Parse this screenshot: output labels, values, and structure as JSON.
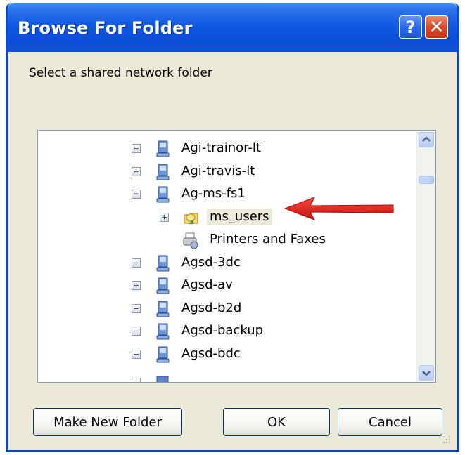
{
  "window": {
    "title": "Browse For Folder",
    "help_label": "?",
    "close_label": "✕"
  },
  "prompt": "Select a shared network folder",
  "tree": {
    "items": [
      {
        "label": "Agi-trainor-lt",
        "icon": "computer-icon",
        "expander": "+",
        "level": 1
      },
      {
        "label": "Agi-travis-lt",
        "icon": "computer-icon",
        "expander": "+",
        "level": 1
      },
      {
        "label": "Ag-ms-fs1",
        "icon": "computer-icon",
        "expander": "−",
        "level": 1
      },
      {
        "label": "ms_users",
        "icon": "shared-folder-icon",
        "expander": "+",
        "level": 2,
        "selected": true
      },
      {
        "label": "Printers and Faxes",
        "icon": "printer-icon",
        "expander": "",
        "level": 2
      },
      {
        "label": "Agsd-3dc",
        "icon": "computer-icon",
        "expander": "+",
        "level": 1
      },
      {
        "label": "Agsd-av",
        "icon": "computer-icon",
        "expander": "+",
        "level": 1
      },
      {
        "label": "Agsd-b2d",
        "icon": "computer-icon",
        "expander": "+",
        "level": 1
      },
      {
        "label": "Agsd-backup",
        "icon": "computer-icon",
        "expander": "+",
        "level": 1
      },
      {
        "label": "Agsd-bdc",
        "icon": "computer-icon",
        "expander": "+",
        "level": 1
      }
    ]
  },
  "buttons": {
    "make_new_folder": "Make New Folder",
    "ok": "OK",
    "cancel": "Cancel"
  },
  "colors": {
    "titlebar": "#0b55e0",
    "dialog_bg": "#ece9d8",
    "annotation_arrow": "#e0201c"
  }
}
